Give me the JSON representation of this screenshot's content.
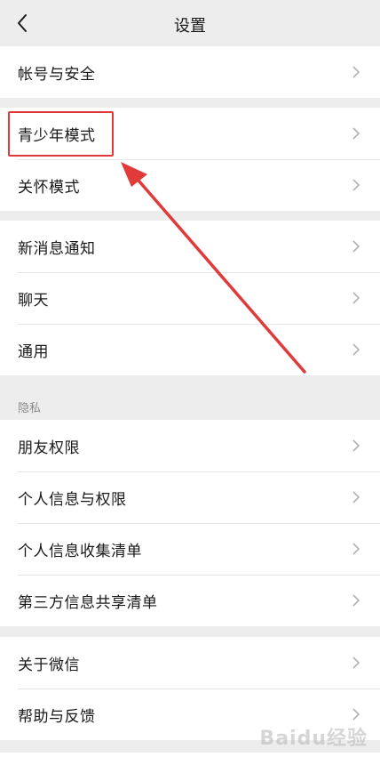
{
  "header": {
    "title": "设置",
    "back_icon": "chevron-left-icon"
  },
  "groups": [
    {
      "items": [
        {
          "label": "帐号与安全"
        }
      ]
    },
    {
      "items": [
        {
          "label": "青少年模式"
        },
        {
          "label": "关怀模式"
        }
      ]
    },
    {
      "items": [
        {
          "label": "新消息通知"
        },
        {
          "label": "聊天"
        },
        {
          "label": "通用"
        }
      ]
    },
    {
      "header": "隐私",
      "items": [
        {
          "label": "朋友权限"
        },
        {
          "label": "个人信息与权限"
        },
        {
          "label": "个人信息收集清单"
        },
        {
          "label": "第三方信息共享清单"
        }
      ]
    },
    {
      "items": [
        {
          "label": "关于微信"
        },
        {
          "label": "帮助与反馈"
        }
      ]
    }
  ],
  "annotation": {
    "color": "#e03a3a"
  },
  "watermark": "Baidu经验",
  "colors": {
    "background": "#ededed",
    "cell": "#ffffff",
    "text": "#191919",
    "chevron": "#b2b2b2"
  }
}
